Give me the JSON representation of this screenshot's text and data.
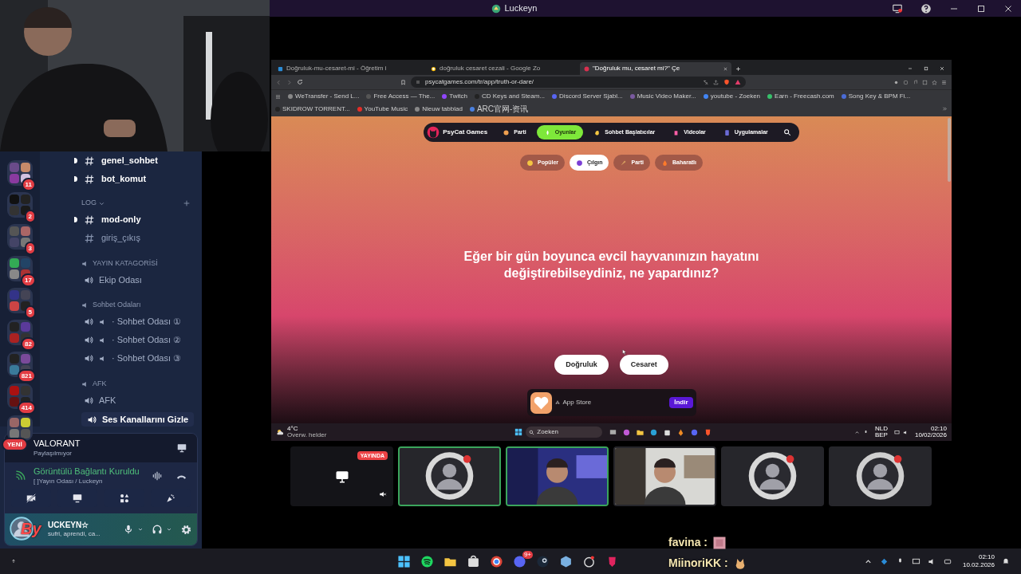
{
  "window": {
    "title": "Luckeyn"
  },
  "discord": {
    "servers": [
      {
        "badge": "11"
      },
      {
        "badge": "2"
      },
      {
        "badge": "3"
      },
      {
        "badge": "17"
      },
      {
        "badge": "5"
      },
      {
        "badge": "82"
      },
      {
        "badge": "821"
      },
      {
        "badge": "414"
      },
      {
        "badge": "YENİ"
      }
    ],
    "channels": [
      {
        "kind": "text",
        "name": "genel_sohbet",
        "unread": true
      },
      {
        "kind": "text",
        "name": "bot_komut",
        "unread": true
      },
      {
        "kind": "category",
        "name": "LOG"
      },
      {
        "kind": "text",
        "name": "mod-only",
        "unread": true
      },
      {
        "kind": "text",
        "name": "giriş_çıkış",
        "unread": false
      },
      {
        "kind": "label",
        "name": "YAYIN KATAGORİSİ"
      },
      {
        "kind": "voice",
        "name": "Ekip Odası"
      },
      {
        "kind": "label",
        "name": "Sohbet Odaları"
      },
      {
        "kind": "room",
        "name": "· Sohbet Odası ①"
      },
      {
        "kind": "room",
        "name": "· Sohbet Odası ②"
      },
      {
        "kind": "room",
        "name": "· Sohbet Odası ③"
      },
      {
        "kind": "label",
        "name": "AFK"
      },
      {
        "kind": "voice",
        "name": "AFK"
      }
    ],
    "hide_button": "Ses Kanallarını Gizle",
    "activity": {
      "game": "VALORANT",
      "status": "Paylaşılmıyor"
    },
    "voice": {
      "status": "Görüntülü Bağlantı Kuruldu",
      "channel": "[ ]Yayın Odası / Luckeyn"
    },
    "user": {
      "sticker": "By",
      "name": "UCKEYN☆",
      "status": "sufri, aprendi, ca..."
    }
  },
  "browser": {
    "tabs": [
      {
        "title": "Doğruluk-mu-cesaret-mi - Öğretim i",
        "selected": false
      },
      {
        "title": "doğruluk cesaret cezali - Google Zo",
        "selected": false
      },
      {
        "title": "\"Doğruluk mu, cesaret mi?\" Çe",
        "selected": true
      }
    ],
    "url": "psycatgames.com/tr/app/truth-or-dare/",
    "bookmarks": [
      "WeTransfer - Send L...",
      "Free Access — The...",
      "Twitch",
      "CD Keys and Steam...",
      "Discord Server Sjabl...",
      "Music Video Maker...",
      "youtube - Zoeken",
      "Earn - Freecash.com",
      "Song Key & BPM Fi...",
      "SKIDROW TORRENT...",
      "YouTube Music",
      "Nieuw tabblad",
      "ARC官网-资讯"
    ]
  },
  "site": {
    "brand": "PsyCat Games",
    "nav": [
      {
        "label": "Parti",
        "selected": false
      },
      {
        "label": "Oyunlar",
        "selected": true
      },
      {
        "label": "Sohbet Başlatıcılar",
        "selected": false
      },
      {
        "label": "Videolar",
        "selected": false
      },
      {
        "label": "Uygulamalar",
        "selected": false
      }
    ],
    "categories": [
      {
        "label": "Popüler",
        "selected": false
      },
      {
        "label": "Çılgın",
        "selected": true
      },
      {
        "label": "Parti",
        "selected": false
      },
      {
        "label": "Baharatlı",
        "selected": false
      }
    ],
    "question": "Eğer bir gün boyunca evcil hayvanınızın hayatını değiştirebilseydiniz, ne yapardınız?",
    "buttons": [
      "Doğruluk",
      "Cesaret"
    ],
    "ad": {
      "store": "App Store",
      "button": "İndir"
    }
  },
  "shared_taskbar": {
    "temperature": "4°C",
    "weather": "Overw. helder",
    "search": "Zoeken",
    "lang": "NLD",
    "layout": "BEP",
    "time": "02:10",
    "date": "10/02/2026"
  },
  "tiles": [
    {
      "kind": "stream",
      "badge": "YAYINDA",
      "speaking": false
    },
    {
      "kind": "avatar",
      "speaking": true
    },
    {
      "kind": "camera",
      "speaking": true
    },
    {
      "kind": "camera",
      "speaking": false
    },
    {
      "kind": "avatar",
      "speaking": false
    },
    {
      "kind": "avatar",
      "speaking": false
    }
  ],
  "chat": [
    {
      "user": "favina :"
    },
    {
      "user": "MiinoriKK :"
    }
  ],
  "taskbar": {
    "discord_badge": "9+",
    "time": "02:10",
    "date": "10.02.2026"
  }
}
